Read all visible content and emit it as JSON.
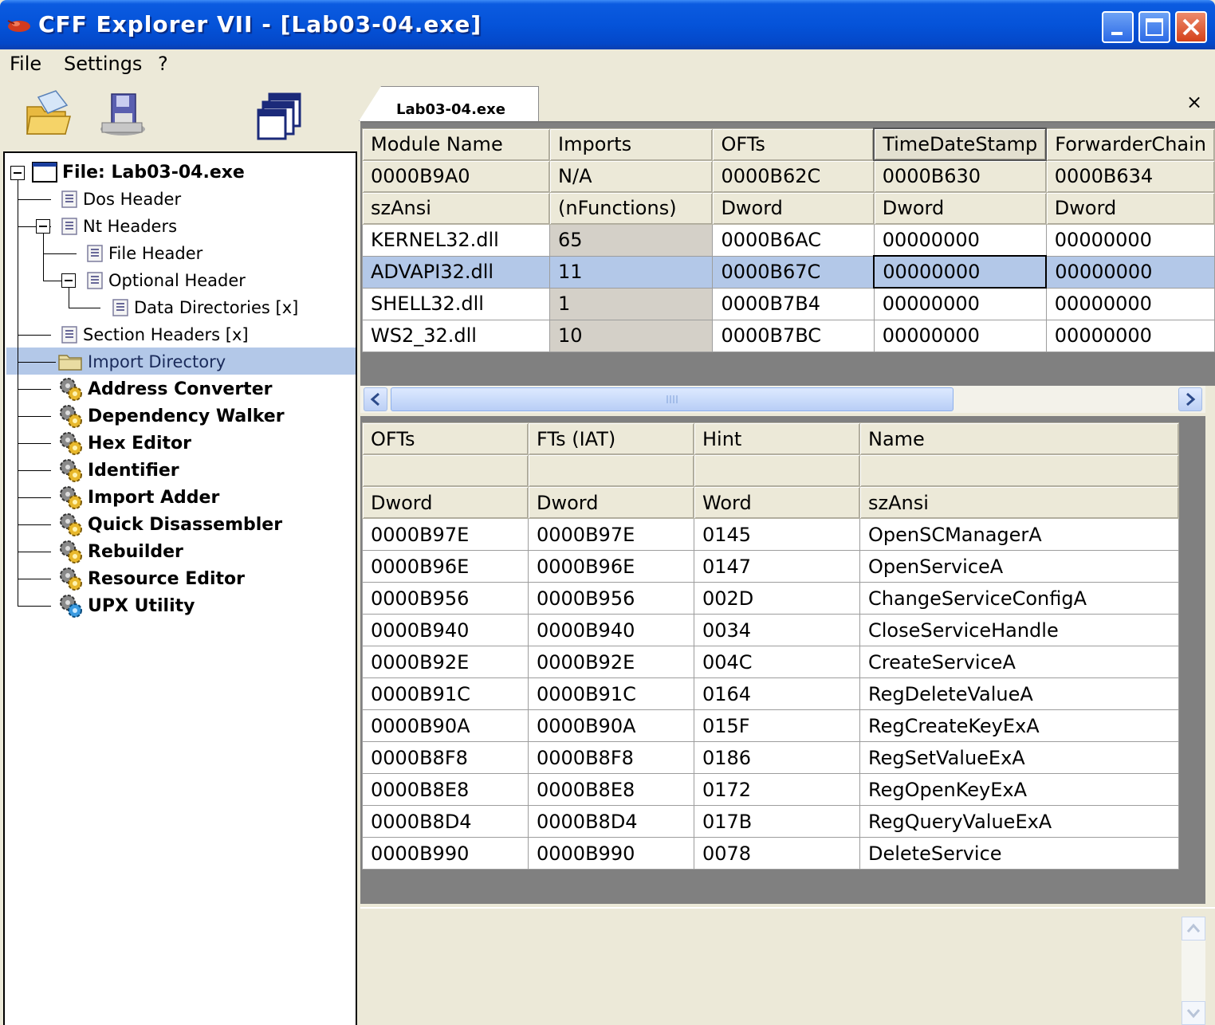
{
  "window": {
    "title": "CFF Explorer VII - [Lab03-04.exe]"
  },
  "menu": [
    "File",
    "Settings",
    "?"
  ],
  "toolbar": [
    "open-icon",
    "save-icon",
    "windows-icon"
  ],
  "tree": {
    "root": "File: Lab03-04.exe",
    "nodes": [
      "Dos Header",
      "Nt Headers",
      "File Header",
      "Optional Header",
      "Data Directories [x]",
      "Section Headers [x]",
      "Import Directory",
      "Address Converter",
      "Dependency Walker",
      "Hex Editor",
      "Identifier",
      "Import Adder",
      "Quick Disassembler",
      "Rebuilder",
      "Resource Editor",
      "UPX Utility"
    ],
    "selected": "Import Directory"
  },
  "tab": {
    "label": "Lab03-04.exe",
    "close": "×"
  },
  "modules": {
    "headers": [
      "Module Name",
      "Imports",
      "OFTs",
      "TimeDateStamp",
      "ForwarderChain"
    ],
    "offsets": [
      "0000B9A0",
      "N/A",
      "0000B62C",
      "0000B630",
      "0000B634"
    ],
    "types": [
      "szAnsi",
      "(nFunctions)",
      "Dword",
      "Dword",
      "Dword"
    ],
    "rows": [
      [
        "KERNEL32.dll",
        "65",
        "0000B6AC",
        "00000000",
        "00000000"
      ],
      [
        "ADVAPI32.dll",
        "11",
        "0000B67C",
        "00000000",
        "00000000"
      ],
      [
        "SHELL32.dll",
        "1",
        "0000B7B4",
        "00000000",
        "00000000"
      ],
      [
        "WS2_32.dll",
        "10",
        "0000B7BC",
        "00000000",
        "00000000"
      ]
    ],
    "selected_row": 1
  },
  "functions": {
    "headers": [
      "OFTs",
      "FTs (IAT)",
      "Hint",
      "Name"
    ],
    "blank": [
      "",
      "",
      "",
      ""
    ],
    "types": [
      "Dword",
      "Dword",
      "Word",
      "szAnsi"
    ],
    "rows": [
      [
        "0000B97E",
        "0000B97E",
        "0145",
        "OpenSCManagerA"
      ],
      [
        "0000B96E",
        "0000B96E",
        "0147",
        "OpenServiceA"
      ],
      [
        "0000B956",
        "0000B956",
        "002D",
        "ChangeServiceConfigA"
      ],
      [
        "0000B940",
        "0000B940",
        "0034",
        "CloseServiceHandle"
      ],
      [
        "0000B92E",
        "0000B92E",
        "004C",
        "CreateServiceA"
      ],
      [
        "0000B91C",
        "0000B91C",
        "0164",
        "RegDeleteValueA"
      ],
      [
        "0000B90A",
        "0000B90A",
        "015F",
        "RegCreateKeyExA"
      ],
      [
        "0000B8F8",
        "0000B8F8",
        "0186",
        "RegSetValueExA"
      ],
      [
        "0000B8E8",
        "0000B8E8",
        "0172",
        "RegOpenKeyExA"
      ],
      [
        "0000B8D4",
        "0000B8D4",
        "017B",
        "RegQueryValueExA"
      ],
      [
        "0000B990",
        "0000B990",
        "0078",
        "DeleteService"
      ]
    ]
  }
}
